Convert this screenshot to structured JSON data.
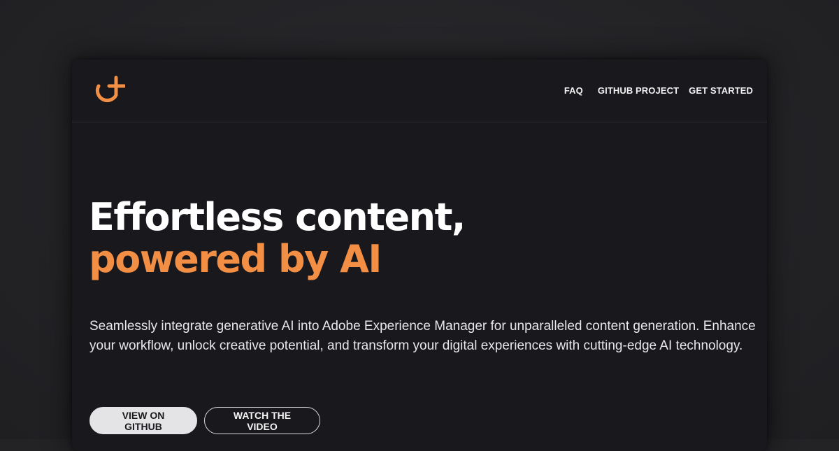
{
  "colors": {
    "accent": "#f28f45",
    "background": "#18181d",
    "page_backdrop": "#232326",
    "text": "#ffffff"
  },
  "header": {
    "logo_icon": "orange-loop-mark-icon",
    "nav": {
      "faq": "FAQ",
      "github_project": "GITHUB PROJECT",
      "get_started": "GET STARTED"
    }
  },
  "hero": {
    "headline_line1": "Effortless content,",
    "headline_line2": "powered by AI",
    "description": "Seamlessly integrate generative AI into Adobe Experience Manager for unparalleled content generation. Enhance your workflow, unlock creative potential, and transform your digital experiences with cutting-edge AI technology.",
    "primary_button": "VIEW ON GITHUB",
    "secondary_button": "WATCH THE VIDEO"
  }
}
